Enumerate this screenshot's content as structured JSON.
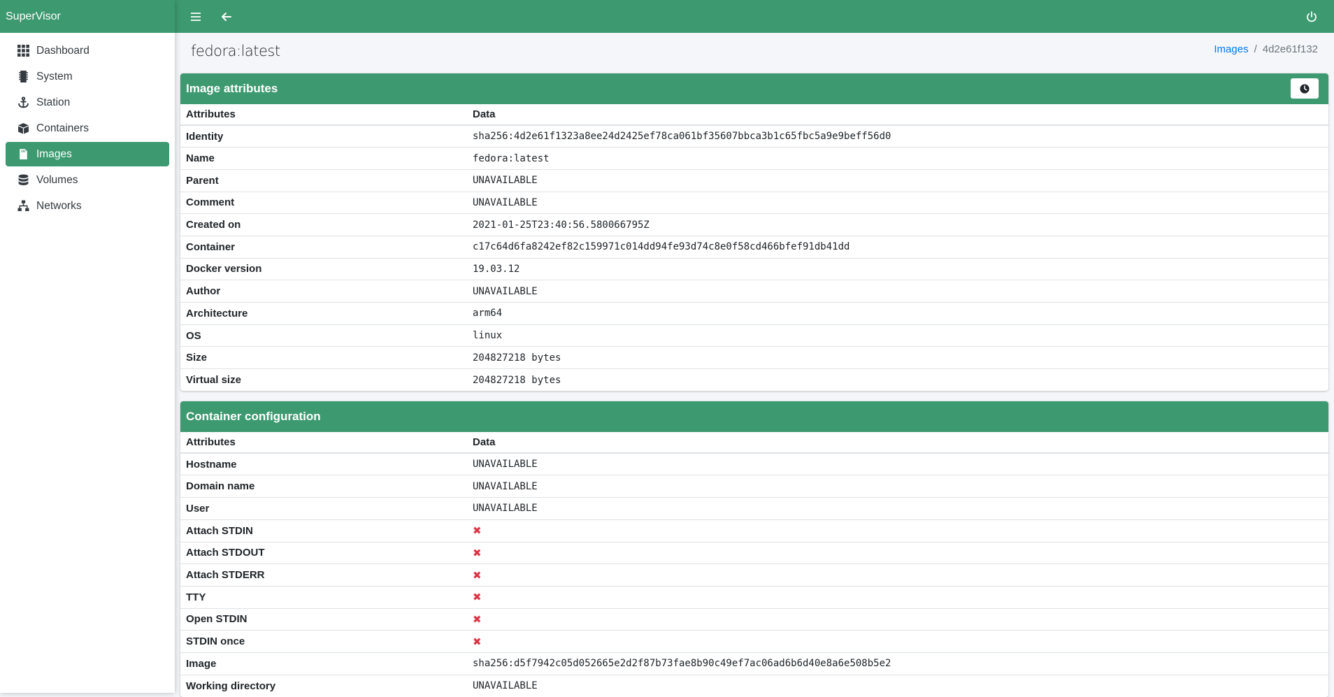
{
  "app": {
    "brand": "SuperVisor"
  },
  "sidebar": {
    "items": [
      {
        "label": "Dashboard",
        "icon": "grid-icon",
        "active": false
      },
      {
        "label": "System",
        "icon": "sd-card-icon",
        "active": false
      },
      {
        "label": "Station",
        "icon": "anchor-icon",
        "active": false
      },
      {
        "label": "Containers",
        "icon": "boxes-icon",
        "active": false
      },
      {
        "label": "Images",
        "icon": "file-icon",
        "active": true
      },
      {
        "label": "Volumes",
        "icon": "database-icon",
        "active": false
      },
      {
        "label": "Networks",
        "icon": "network-icon",
        "active": false
      }
    ]
  },
  "topbar": {
    "menu_icon": "hamburger-icon",
    "back_icon": "arrow-left-icon",
    "power_icon": "power-icon"
  },
  "page": {
    "title": "fedora:latest",
    "breadcrumb": {
      "link": "Images",
      "current": "4d2e61f132"
    }
  },
  "image_attributes": {
    "title": "Image attributes",
    "col_attr": "Attributes",
    "col_data": "Data",
    "history_icon": "clock-icon",
    "rows": [
      {
        "attr": "Identity",
        "value": "sha256:4d2e61f1323a8ee24d2425ef78ca061bf35607bbca3b1c65fbc5a9e9beff56d0"
      },
      {
        "attr": "Name",
        "value": "fedora:latest"
      },
      {
        "attr": "Parent",
        "value": "UNAVAILABLE"
      },
      {
        "attr": "Comment",
        "value": "UNAVAILABLE"
      },
      {
        "attr": "Created on",
        "value": "2021-01-25T23:40:56.580066795Z"
      },
      {
        "attr": "Container",
        "value": "c17c64d6fa8242ef82c159971c014dd94fe93d74c8e0f58cd466bfef91db41dd"
      },
      {
        "attr": "Docker version",
        "value": "19.03.12"
      },
      {
        "attr": "Author",
        "value": "UNAVAILABLE"
      },
      {
        "attr": "Architecture",
        "value": "arm64"
      },
      {
        "attr": "OS",
        "value": "linux"
      },
      {
        "attr": "Size",
        "value": "204827218 bytes"
      },
      {
        "attr": "Virtual size",
        "value": "204827218 bytes"
      }
    ]
  },
  "container_config": {
    "title": "Container configuration",
    "col_attr": "Attributes",
    "col_data": "Data",
    "false_mark": "✖",
    "rows": [
      {
        "attr": "Hostname",
        "value": "UNAVAILABLE"
      },
      {
        "attr": "Domain name",
        "value": "UNAVAILABLE"
      },
      {
        "attr": "User",
        "value": "UNAVAILABLE"
      },
      {
        "attr": "Attach STDIN",
        "value": "✖"
      },
      {
        "attr": "Attach STDOUT",
        "value": "✖"
      },
      {
        "attr": "Attach STDERR",
        "value": "✖"
      },
      {
        "attr": "TTY",
        "value": "✖"
      },
      {
        "attr": "Open STDIN",
        "value": "✖"
      },
      {
        "attr": "STDIN once",
        "value": "✖"
      },
      {
        "attr": "Image",
        "value": "sha256:d5f7942c05d052665e2d2f87b73fae8b90c49ef7ac06ad6b6d40e8a6e508b5e2"
      },
      {
        "attr": "Working directory",
        "value": "UNAVAILABLE"
      }
    ]
  },
  "colors": {
    "accent": "#3d9970",
    "link": "#007bff",
    "false_mark": "#dc3545"
  }
}
